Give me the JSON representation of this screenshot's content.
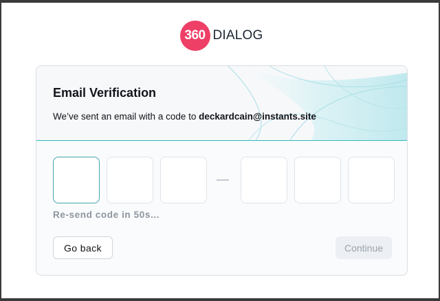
{
  "brand": {
    "badge_text": "360",
    "wordmark": "DIALOG",
    "badge_color": "#ee3f66"
  },
  "card": {
    "title": "Email Verification",
    "subtitle_prefix": "We’ve sent an email with a code to ",
    "email": "deckardcain@instants.site",
    "accent_color": "#34b7bf"
  },
  "code": {
    "group_one": [
      "",
      "",
      ""
    ],
    "group_two": [
      "",
      "",
      ""
    ],
    "separator": "—"
  },
  "resend_text": "Re-send code in 50s...",
  "buttons": {
    "back_label": "Go back",
    "continue_label": "Continue"
  }
}
